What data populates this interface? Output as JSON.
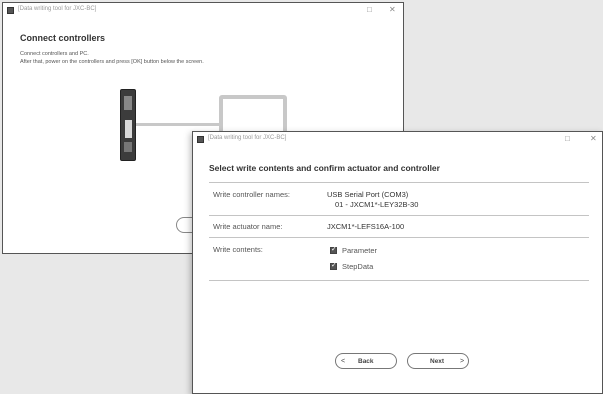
{
  "window1": {
    "title": "[Data writing tool for JXC-BC]",
    "minimize_glyph": "□",
    "close_glyph": "✕",
    "heading": "Connect controllers",
    "instruction_line1": "Connect controllers and PC.",
    "instruction_line2": "After that, power on the controllers and press [OK] button below the screen."
  },
  "window2": {
    "title": "[Data writing tool for JXC-BC]",
    "minimize_glyph": "□",
    "close_glyph": "✕",
    "heading": "Select write contents and confirm actuator and controller",
    "rows": [
      {
        "label": "Write controller names:",
        "value_line1": "USB Serial Port (COM3)",
        "value_line2": "01 - JXCM1*-LEY32B-30"
      },
      {
        "label": "Write actuator name:",
        "value": "JXCM1*-LEFS16A-100"
      },
      {
        "label": "Write contents:",
        "options": [
          {
            "label": "Parameter",
            "checked": true
          },
          {
            "label": "StepData",
            "checked": true
          }
        ]
      }
    ],
    "back_label": "Back",
    "back_arrow": "<",
    "next_label": "Next",
    "next_arrow": ">"
  },
  "icons": {
    "app": "app-icon",
    "checkbox_mark": "✓"
  }
}
